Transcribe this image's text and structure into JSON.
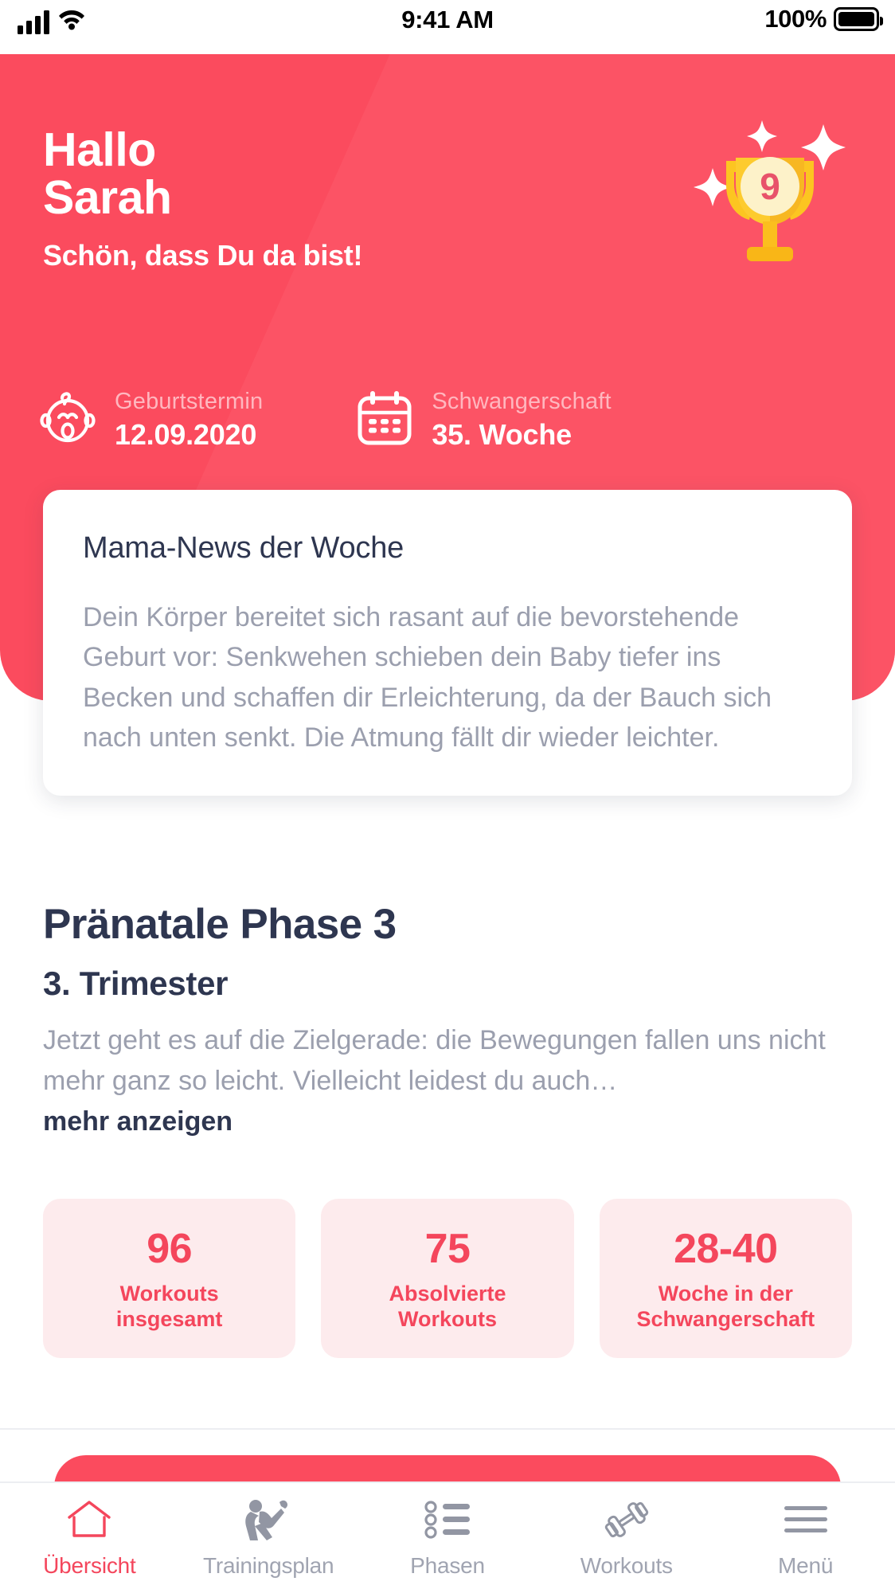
{
  "colors": {
    "brand_red": "#fb4b5e",
    "accent_red": "#f4465c",
    "stat_bg": "#fdebed",
    "navy": "#2e3650",
    "muted_grey": "#9b9fae",
    "nav_inactive": "#a0a4b1",
    "trophy_gold": "#f7b731",
    "trophy_light": "#fccf4d"
  },
  "statusbar": {
    "signal_icon": "signal-bars-icon",
    "wifi_icon": "wifi-icon",
    "time": "9:41 AM",
    "battery_percent": "100%",
    "battery_icon": "battery-full-icon"
  },
  "header": {
    "greeting_line1": "Hallo",
    "greeting_line2": "Sarah",
    "subtitle": "Schön, dass Du da bist!",
    "trophy": {
      "icon": "trophy-icon",
      "badge_number": "9",
      "sparkle_icon": "sparkle-icon"
    },
    "info": [
      {
        "icon": "baby-face-icon",
        "label": "Geburtstermin",
        "value": "12.09.2020"
      },
      {
        "icon": "calendar-icon",
        "label": "Schwangerschaft",
        "value": "35. Woche"
      }
    ]
  },
  "news_card": {
    "title": "Mama-News der Woche",
    "body": "Dein Körper bereitet sich rasant auf die bevorstehende Geburt vor: Senkwehen schieben dein Baby tiefer ins Becken und schaffen dir Erleichterung, da der Bauch sich nach unten senkt. Die Atmung fällt dir wieder leichter."
  },
  "phase": {
    "title": "Pränatale Phase 3",
    "subtitle": "3. Trimester",
    "description": "Jetzt geht es auf die Zielgerade: die Bewegungen fallen uns nicht mehr ganz so leicht. Vielleicht leidest du auch…",
    "more_link": "mehr anzeigen"
  },
  "stats": [
    {
      "value": "96",
      "caption_line1": "Workouts",
      "caption_line2": "insgesamt"
    },
    {
      "value": "75",
      "caption_line1": "Absolvierte",
      "caption_line2": "Workouts"
    },
    {
      "value": "28-40",
      "caption_line1": "Woche in der",
      "caption_line2": "Schwangerschaft"
    }
  ],
  "bottom_nav": {
    "items": [
      {
        "label": "Übersicht",
        "icon": "home-icon",
        "active": true
      },
      {
        "label": "Trainingsplan",
        "icon": "yoga-pose-icon",
        "active": false
      },
      {
        "label": "Phasen",
        "icon": "list-bullet-icon",
        "active": false
      },
      {
        "label": "Workouts",
        "icon": "dumbbell-icon",
        "active": false
      },
      {
        "label": "Menü",
        "icon": "hamburger-menu-icon",
        "active": false
      }
    ]
  }
}
